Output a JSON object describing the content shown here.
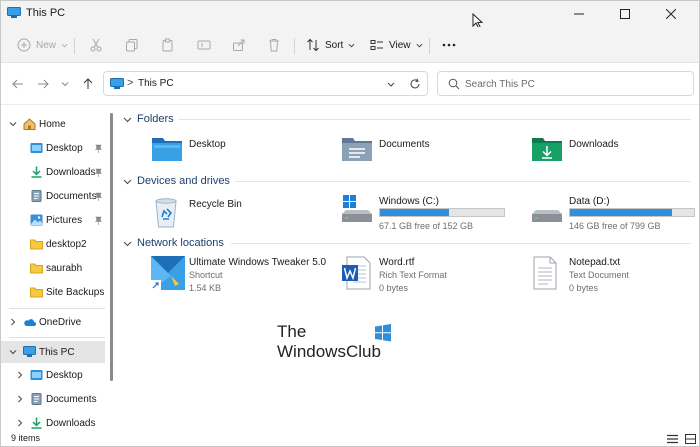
{
  "window": {
    "title": "This PC"
  },
  "toolbar": {
    "new_label": "New",
    "sort_label": "Sort",
    "view_label": "View"
  },
  "address": {
    "path": "This PC",
    "separator": ">"
  },
  "search": {
    "placeholder": "Search This PC"
  },
  "sidebar": {
    "items": [
      {
        "label": "Home",
        "icon": "home-icon",
        "level": 0,
        "expandable": true,
        "expanded": true,
        "pinned": false
      },
      {
        "label": "Desktop",
        "icon": "desktop-folder-icon",
        "level": 1,
        "pinned": true
      },
      {
        "label": "Downloads",
        "icon": "downloads-icon",
        "level": 1,
        "pinned": true
      },
      {
        "label": "Documents",
        "icon": "documents-icon",
        "level": 1,
        "pinned": true
      },
      {
        "label": "Pictures",
        "icon": "pictures-icon",
        "level": 1,
        "pinned": true
      },
      {
        "label": "desktop2",
        "icon": "folder-icon",
        "level": 1,
        "pinned": false
      },
      {
        "label": "saurabh",
        "icon": "folder-icon",
        "level": 1,
        "pinned": false
      },
      {
        "label": "Site Backups",
        "icon": "folder-icon",
        "level": 1,
        "pinned": false
      },
      {
        "label": "OneDrive",
        "icon": "onedrive-icon",
        "level": 0,
        "expandable": true,
        "expanded": false
      },
      {
        "label": "This PC",
        "icon": "this-pc-icon",
        "level": 0,
        "expandable": true,
        "expanded": true,
        "selected": true
      },
      {
        "label": "Desktop",
        "icon": "desktop-folder-icon",
        "level": 1,
        "expandable": true
      },
      {
        "label": "Documents",
        "icon": "documents-icon",
        "level": 1,
        "expandable": true
      },
      {
        "label": "Downloads",
        "icon": "downloads-icon",
        "level": 1,
        "expandable": true
      }
    ]
  },
  "groups": {
    "folders": "Folders",
    "devices": "Devices and drives",
    "network": "Network locations"
  },
  "folders": [
    {
      "name": "Desktop",
      "icon": "desktop-folder-icon"
    },
    {
      "name": "Documents",
      "icon": "documents-folder-icon"
    },
    {
      "name": "Downloads",
      "icon": "downloads-folder-icon"
    }
  ],
  "devices": [
    {
      "name": "Recycle Bin",
      "icon": "recycle-bin-icon"
    },
    {
      "name": "Windows (C:)",
      "free": "67.1 GB free of 152 GB",
      "used_fraction": 0.56,
      "icon": "windows-drive-icon"
    },
    {
      "name": "Data (D:)",
      "free": "146 GB free of 799 GB",
      "used_fraction": 0.82,
      "icon": "drive-icon"
    }
  ],
  "network": [
    {
      "name": "Ultimate Windows Tweaker 5.0",
      "type": "Shortcut",
      "size": "1.54 KB",
      "icon": "uwt-shortcut-icon"
    },
    {
      "name": "Word.rtf",
      "type": "Rich Text Format",
      "size": "0 bytes",
      "icon": "word-document-icon"
    },
    {
      "name": "Notepad.txt",
      "type": "Text Document",
      "size": "0 bytes",
      "icon": "text-document-icon"
    }
  ],
  "watermark": {
    "line1": "The",
    "line2": "WindowsClub"
  },
  "status": {
    "item_count": "9 items"
  },
  "colors": {
    "accent": "#2f8fda",
    "group_header": "#1e3f6b",
    "selection": "#e5e5e5"
  }
}
